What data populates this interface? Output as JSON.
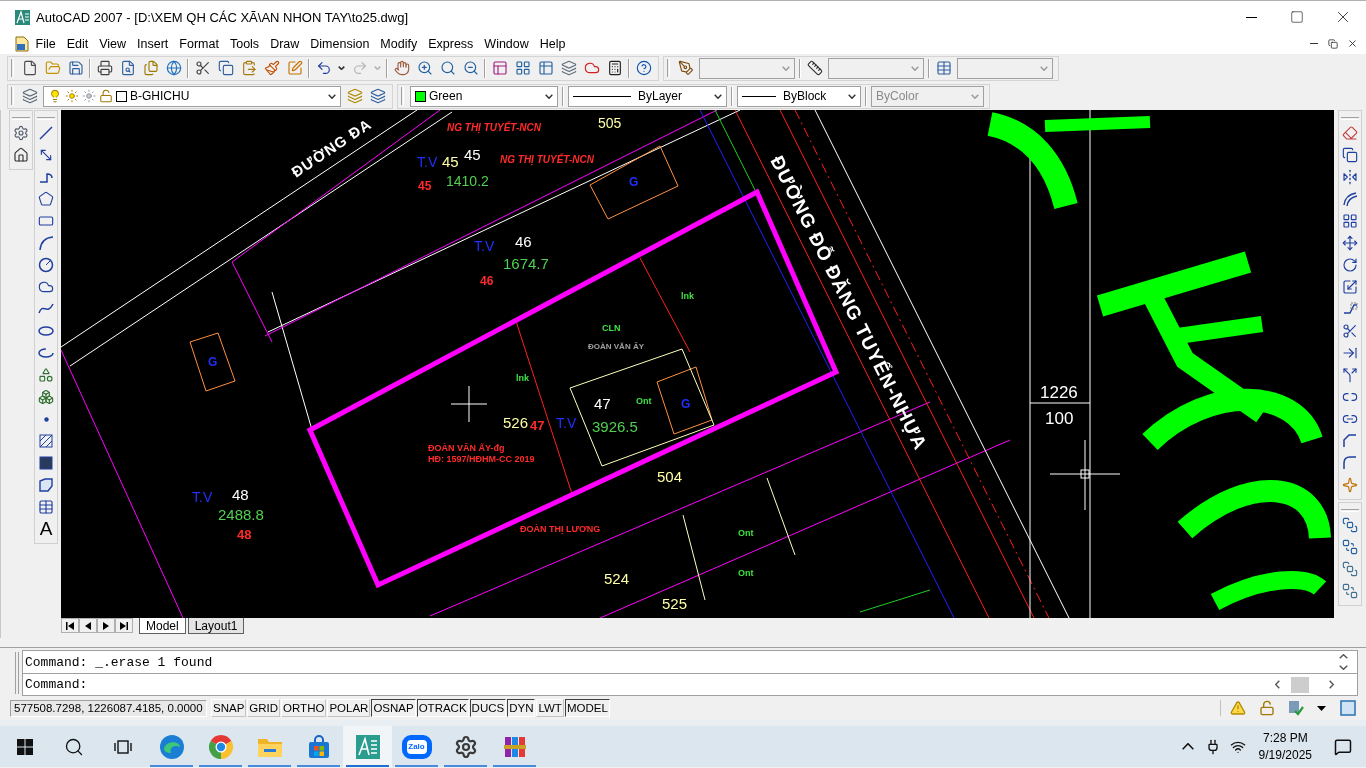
{
  "window": {
    "title": "AutoCAD 2007 - [D:\\XEM QH CÁC XÃ\\AN NHON TAY\\to25.dwg]"
  },
  "menu_bar": {
    "items": [
      "File",
      "Edit",
      "View",
      "Insert",
      "Format",
      "Tools",
      "Draw",
      "Dimension",
      "Modify",
      "Express",
      "Window",
      "Help"
    ]
  },
  "standard_toolbar": {
    "groups": [
      [
        {
          "kind": "new",
          "disabled": false
        },
        {
          "kind": "open",
          "disabled": false
        },
        {
          "kind": "save",
          "disabled": false
        }
      ],
      [
        {
          "kind": "plot",
          "disabled": false
        },
        {
          "kind": "preview",
          "disabled": false
        },
        {
          "kind": "publish",
          "disabled": false
        },
        {
          "kind": "dwf",
          "disabled": false
        }
      ],
      [
        {
          "kind": "cut",
          "disabled": false
        },
        {
          "kind": "copy",
          "disabled": false
        },
        {
          "kind": "paste",
          "disabled": false
        },
        {
          "kind": "match",
          "disabled": false
        },
        {
          "kind": "blockedit",
          "disabled": false
        }
      ],
      [
        {
          "kind": "undo",
          "disabled": false
        },
        {
          "kind": "undo-list",
          "disabled": false
        },
        {
          "kind": "redo",
          "disabled": true
        },
        {
          "kind": "redo-list",
          "disabled": true
        }
      ],
      [
        {
          "kind": "pan",
          "disabled": false
        },
        {
          "kind": "zoom",
          "disabled": false
        },
        {
          "kind": "zoomwin",
          "disabled": false
        },
        {
          "kind": "zoomprev",
          "disabled": false
        }
      ],
      [
        {
          "kind": "props",
          "disabled": false
        },
        {
          "kind": "dc",
          "disabled": false
        },
        {
          "kind": "palettes",
          "disabled": false
        },
        {
          "kind": "sheetset",
          "disabled": false
        },
        {
          "kind": "markup",
          "disabled": false
        },
        {
          "kind": "calc",
          "disabled": false
        }
      ],
      [
        {
          "kind": "help",
          "disabled": false
        }
      ]
    ]
  },
  "styles_toolbar": {
    "dropdowns": [
      {
        "kind": "text",
        "disabled": true
      },
      {
        "kind": "dimension",
        "disabled": true
      },
      {
        "kind": "table",
        "disabled": true
      }
    ]
  },
  "layers_toolbar": {
    "layer": {
      "name": "B-GHICHU",
      "on": true,
      "frozen": false,
      "locked": false,
      "color": "#ffffff"
    }
  },
  "properties_toolbar": {
    "color": {
      "value": "Green",
      "color": "#00ff00"
    },
    "linetype": {
      "value": "ByLayer"
    },
    "lineweight": {
      "value": "ByBlock"
    },
    "plot_style": {
      "value": "ByColor",
      "disabled": true
    }
  },
  "draw_toolbar": {
    "text_tool": "A"
  },
  "drawing": {
    "labels": [
      {
        "text": "ĐƯỜNG ĐA",
        "kind": "road",
        "color": "#ffffff"
      },
      {
        "text": "NG THỊ TUYẾT-NCN",
        "kind": "note",
        "color": "#ff2a2a"
      },
      {
        "text": "505",
        "kind": "note",
        "color": "#ffffa8"
      },
      {
        "text": "T.V",
        "kind": "note",
        "color": "#2030ff"
      },
      {
        "text": "45",
        "kind": "note",
        "color": "#ffffa8"
      },
      {
        "text": "45",
        "kind": "note",
        "color": "#ffffff"
      },
      {
        "text": "NG THỊ TUYẾT-NCN",
        "kind": "note",
        "color": "#ff2a2a"
      },
      {
        "text": "45",
        "kind": "note",
        "color": "#ff2a2a"
      },
      {
        "text": "1410.2",
        "kind": "note",
        "color": "#50d050"
      },
      {
        "text": "G",
        "kind": "note",
        "color": "#2030ff"
      },
      {
        "text": "T.V",
        "kind": "note",
        "color": "#2030ff"
      },
      {
        "text": "46",
        "kind": "note",
        "color": "#ffffff"
      },
      {
        "text": "1674.7",
        "kind": "note",
        "color": "#50d050"
      },
      {
        "text": "46",
        "kind": "note",
        "color": "#ff2a2a"
      },
      {
        "text": "lnk",
        "kind": "note",
        "color": "#40e040"
      },
      {
        "text": "CLN",
        "kind": "note",
        "color": "#40e040"
      },
      {
        "text": "ĐOÀN VĂN ẤY",
        "kind": "note",
        "color": "#a0a0a0"
      },
      {
        "text": "G",
        "kind": "note",
        "color": "#2030ff"
      },
      {
        "text": "lnk",
        "kind": "note",
        "color": "#40e040"
      },
      {
        "text": "47",
        "kind": "note",
        "color": "#ffffff"
      },
      {
        "text": "Ont",
        "kind": "note",
        "color": "#40e040"
      },
      {
        "text": "G",
        "kind": "note",
        "color": "#2030ff"
      },
      {
        "text": "526",
        "kind": "note",
        "color": "#ffffa8"
      },
      {
        "text": "47",
        "kind": "note",
        "color": "#ff2a2a"
      },
      {
        "text": "T.V",
        "kind": "note",
        "color": "#2030ff"
      },
      {
        "text": "3926.5",
        "kind": "note",
        "color": "#50d050"
      },
      {
        "text": "ĐOÀN VĂN ẤY-đg",
        "kind": "note",
        "color": "#ff2a2a"
      },
      {
        "text": "HĐ: 1597/HĐHM-CC 2019",
        "kind": "note",
        "color": "#ff2a2a"
      },
      {
        "text": "504",
        "kind": "note",
        "color": "#ffffa8"
      },
      {
        "text": "T.V",
        "kind": "note",
        "color": "#2030ff"
      },
      {
        "text": "48",
        "kind": "note",
        "color": "#ffffff"
      },
      {
        "text": "2488.8",
        "kind": "note",
        "color": "#50d050"
      },
      {
        "text": "48",
        "kind": "note",
        "color": "#ff2a2a"
      },
      {
        "text": "ĐOÀN THỊ LƯƠNG",
        "kind": "note",
        "color": "#ff2a2a"
      },
      {
        "text": "Ont",
        "kind": "note",
        "color": "#40e040"
      },
      {
        "text": "524",
        "kind": "note",
        "color": "#ffffa8"
      },
      {
        "text": "Ont",
        "kind": "note",
        "color": "#40e040"
      },
      {
        "text": "525",
        "kind": "note",
        "color": "#ffffa8"
      },
      {
        "text": "1226",
        "kind": "note",
        "color": "#ffffff"
      },
      {
        "text": "100",
        "kind": "note",
        "color": "#ffffff"
      },
      {
        "text": "ĐƯỜNG ĐỖ ĐĂNG TUYỂN-NHỰA",
        "kind": "road",
        "color": "#ffffff"
      }
    ]
  },
  "layout_tabs": [
    {
      "label": "Model",
      "selected": true
    },
    {
      "label": "Layout1",
      "selected": false
    }
  ],
  "command_line": {
    "history": [
      "Command: _.erase 1 found"
    ],
    "prompt": "Command:"
  },
  "status_bar": {
    "coordinates": "577508.7298, 1226087.4185, 0.0000",
    "toggles": [
      {
        "label": "SNAP",
        "on": false
      },
      {
        "label": "GRID",
        "on": false
      },
      {
        "label": "ORTHO",
        "on": false
      },
      {
        "label": "POLAR",
        "on": false
      },
      {
        "label": "OSNAP",
        "on": true
      },
      {
        "label": "OTRACK",
        "on": true
      },
      {
        "label": "DUCS",
        "on": true
      },
      {
        "label": "DYN",
        "on": true
      },
      {
        "label": "LWT",
        "on": false
      },
      {
        "label": "MODEL",
        "on": true
      }
    ]
  },
  "taskbar": {
    "apps": [
      {
        "kind": "swirl",
        "running": true,
        "selected": false
      },
      {
        "kind": "wheel",
        "running": true,
        "selected": false
      },
      {
        "kind": "folder",
        "running": true,
        "selected": false
      },
      {
        "kind": "bag",
        "running": true,
        "selected": false
      },
      {
        "kind": "cad",
        "running": true,
        "selected": true
      },
      {
        "kind": "chat",
        "label": "Zalo",
        "running": true,
        "selected": false
      },
      {
        "kind": "gear",
        "running": true,
        "selected": false
      },
      {
        "kind": "books",
        "running": true,
        "selected": false
      }
    ],
    "clock": {
      "time": "7:28 PM",
      "date": "9/19/2025"
    }
  }
}
